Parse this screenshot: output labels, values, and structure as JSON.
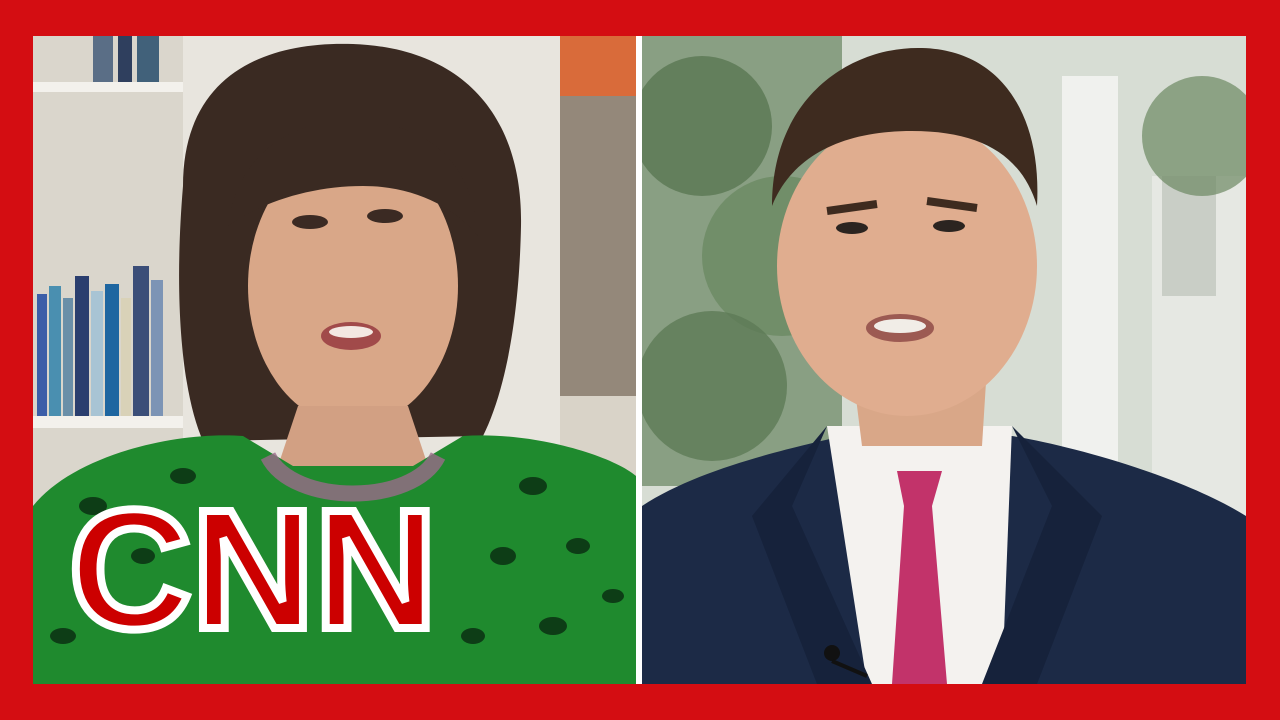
{
  "screen": {
    "frame_color": "#d40d12",
    "divider_color": "#ffffff"
  },
  "left_panel": {
    "subject": "female-anchor",
    "background": "bookshelf-studio",
    "outfit_color": "#1f8a2e"
  },
  "right_panel": {
    "subject": "male-guest-in-suit",
    "background": "white-house-exterior",
    "suit_color": "#1c2a46",
    "tie_color": "#c2336a"
  },
  "logo": {
    "text": "CNN",
    "icon": "cnn-logo",
    "color": "#cc0000"
  }
}
